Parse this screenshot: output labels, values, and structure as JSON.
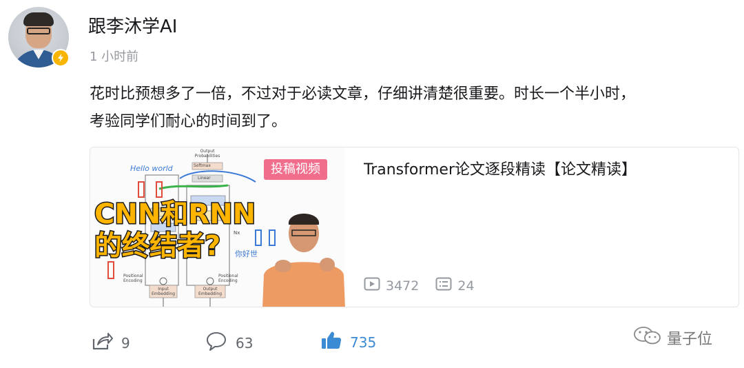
{
  "author": {
    "name": "跟李沐学AI",
    "time": "1 小时前",
    "avatar_icon": "person-avatar-icon",
    "badge_icon": "lightning-badge-icon",
    "badge_color": "#f7b500"
  },
  "post": {
    "text_line1": "花时比预想多了一倍，不过对于必读文章，仔细讲清楚很重要。时长一个半小时，",
    "text_line2": "考验同学们耐心的时间到了。"
  },
  "video": {
    "tag": "投稿视频",
    "tag_color": "#f06d8c",
    "title": "Transformer论文逐段精读【论文精读】",
    "thumbnail_caption_1": "CNN和RNN",
    "thumbnail_caption_2": "的终结者?",
    "views": "3472",
    "comments": "24",
    "views_icon": "play-icon",
    "comments_icon": "danmaku-icon"
  },
  "thumbnail_diagram": {
    "output_label": "Output Probabilities",
    "softmax": "Softmax",
    "linear": "Linear",
    "input_embedding": "Input Embedding",
    "output_embedding": "Output Embedding",
    "pos_encoding_left": "Positional Encoding",
    "pos_encoding_right": "Positional Encoding",
    "hello_world": "Hello world",
    "nx": "Nx",
    "sketch_text": "你好世"
  },
  "actions": {
    "share_count": "9",
    "comment_count": "63",
    "like_count": "735",
    "like_color": "#3a8ad4"
  },
  "watermark": {
    "text": "量子位",
    "icon": "wechat-icon"
  }
}
